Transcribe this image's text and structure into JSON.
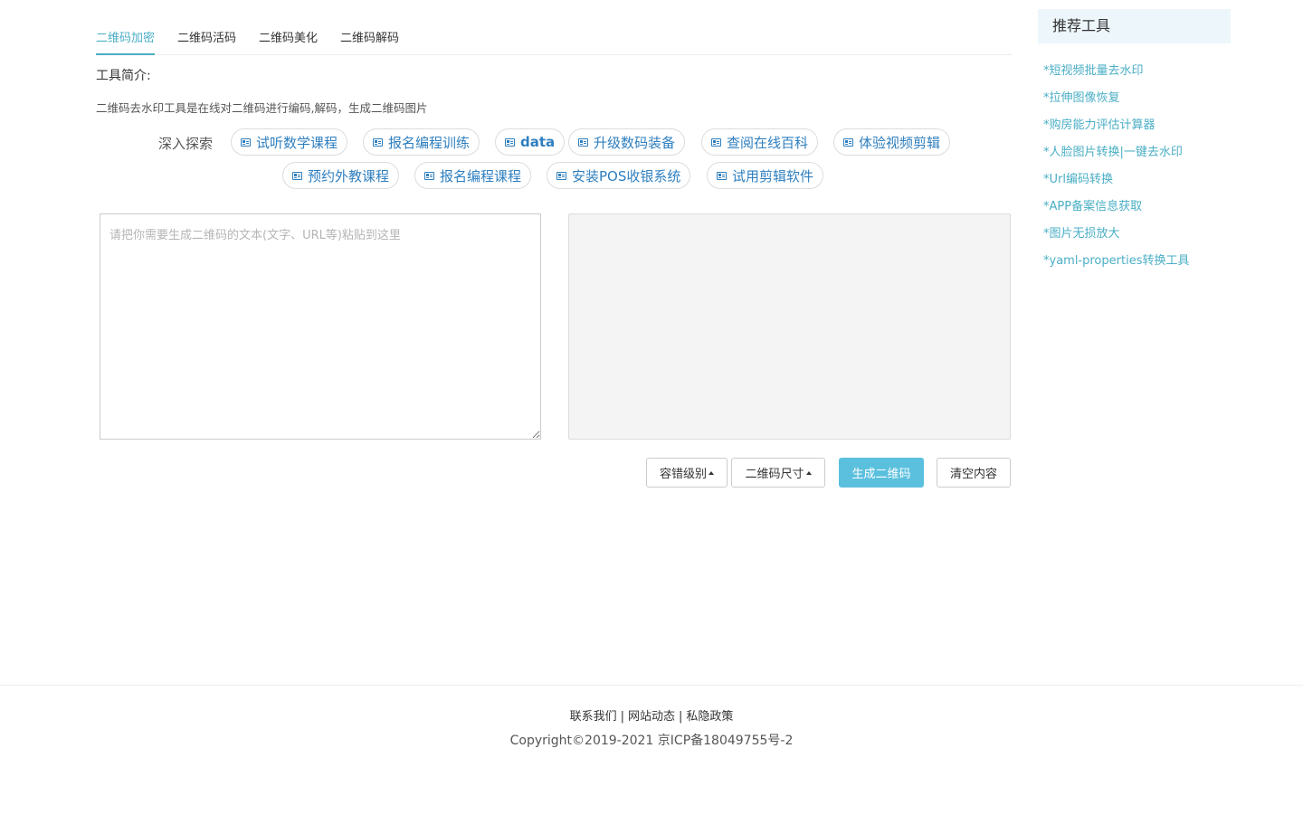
{
  "tabs": [
    {
      "label": "二维码加密",
      "active": true
    },
    {
      "label": "二维码活码",
      "active": false
    },
    {
      "label": "二维码美化",
      "active": false
    },
    {
      "label": "二维码解码",
      "active": false
    }
  ],
  "intro": {
    "heading": "工具简介:",
    "text": "二维码去水印工具是在线对二维码进行编码,解码，生成二维码图片"
  },
  "explore": {
    "label": "深入探索",
    "pills": [
      "试听数学课程",
      "报名编程训练",
      "data",
      "升级数码装备",
      "查阅在线百科",
      "体验视频剪辑",
      "预约外教课程",
      "报名编程课程",
      "安装POS收银系统",
      "试用剪辑软件"
    ]
  },
  "input": {
    "placeholder": "请把你需要生成二维码的文本(文字、URL等)粘贴到这里",
    "value": ""
  },
  "buttons": {
    "error_level": "容错级别",
    "size": "二维码尺寸",
    "generate": "生成二维码",
    "clear": "清空内容"
  },
  "sidebar": {
    "title": "推荐工具",
    "items": [
      "*短视频批量去水印",
      "*拉伸图像恢复",
      "*购房能力评估计算器",
      "*人脸图片转换|一键去水印",
      "*Url编码转换",
      "*APP备案信息获取",
      "*图片无损放大",
      "*yaml-properties转换工具"
    ]
  },
  "footer": {
    "links": [
      "联系我们",
      "网站动态",
      "私隐政策"
    ],
    "separator": "|",
    "copyright": "Copyright©2019-2021 京ICP备18049755号-2"
  },
  "colors": {
    "accent": "#4aaec5",
    "link_blue": "#2f7fbf",
    "primary_button": "#5bc0de",
    "sidebar_header_bg": "#edf6fb",
    "output_bg": "#f4f4f4"
  }
}
